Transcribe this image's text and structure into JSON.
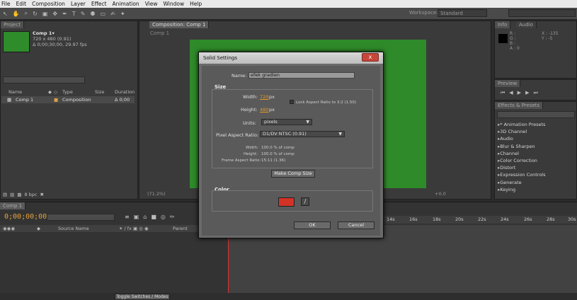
{
  "menu": [
    "File",
    "Edit",
    "Composition",
    "Layer",
    "Effect",
    "Animation",
    "View",
    "Window",
    "Help"
  ],
  "toolbar": {
    "workspace_label": "Workspace:",
    "workspace_value": "Standard"
  },
  "project": {
    "tab": "Project",
    "comp_name": "Comp 1▾",
    "comp_size": "720 x 480 (0.91)",
    "comp_duration": "Δ 0;00;30;00, 29.97 fps",
    "columns": {
      "name": "Name",
      "type": "Type",
      "size": "Size",
      "duration": "Duration"
    },
    "row": {
      "name": "Comp 1",
      "type": "Composition",
      "duration": "Δ 0;00"
    },
    "bpc": "8 bpc"
  },
  "viewer": {
    "tab": "Composition: Comp 1",
    "comp_label": "Comp 1",
    "zoom": "(71.2%)",
    "exposure": "+0.0"
  },
  "info": {
    "tab_info": "Info",
    "tab_audio": "Audio",
    "r": "R :",
    "g": "G :",
    "b": "B :",
    "a": "A : 0",
    "x": "X : -135",
    "y": "Y : -5"
  },
  "preview": {
    "tab": "Preview"
  },
  "effects": {
    "tab": "Effects & Presets",
    "items": [
      "* Animation Presets",
      "3D Channel",
      "Audio",
      "Blur & Sharpen",
      "Channel",
      "Color Correction",
      "Distort",
      "Expression Controls",
      "Generate",
      "Keying"
    ]
  },
  "timeline": {
    "tab": "Comp 1",
    "timecode": "0;00;00;00",
    "source_name": "Source Name",
    "parent": "Parent",
    "ruler": [
      "14s",
      "16s",
      "18s",
      "20s",
      "22s",
      "24s",
      "26s",
      "28s",
      "30s"
    ],
    "toggle": "Toggle Switches / Modes"
  },
  "dialog": {
    "title": "Solid Settings",
    "close": "x",
    "name_label": "Name:",
    "name_value": "efek gradien",
    "size_section": "Size",
    "width_label": "Width:",
    "width_value": "720",
    "height_label": "Height:",
    "height_value": "480",
    "px": "px",
    "lock_label": "Lock Aspect Ratio to 3:2 (1.50)",
    "units_label": "Units:",
    "units_value": "pixels",
    "par_label": "Pixel Aspect Ratio:",
    "par_value": "D1/DV NTSC (0.91)",
    "w_pct_label": "Width:",
    "w_pct_value": "100.0 % of comp",
    "h_pct_label": "Height:",
    "h_pct_value": "100.0 % of comp",
    "far_label": "Frame Aspect Ratio:",
    "far_value": "15:11 (1.36)",
    "make_comp_size": "Make Comp Size",
    "color_section": "Color",
    "color_value": "#d33226",
    "ok": "OK",
    "cancel": "Cancel"
  }
}
